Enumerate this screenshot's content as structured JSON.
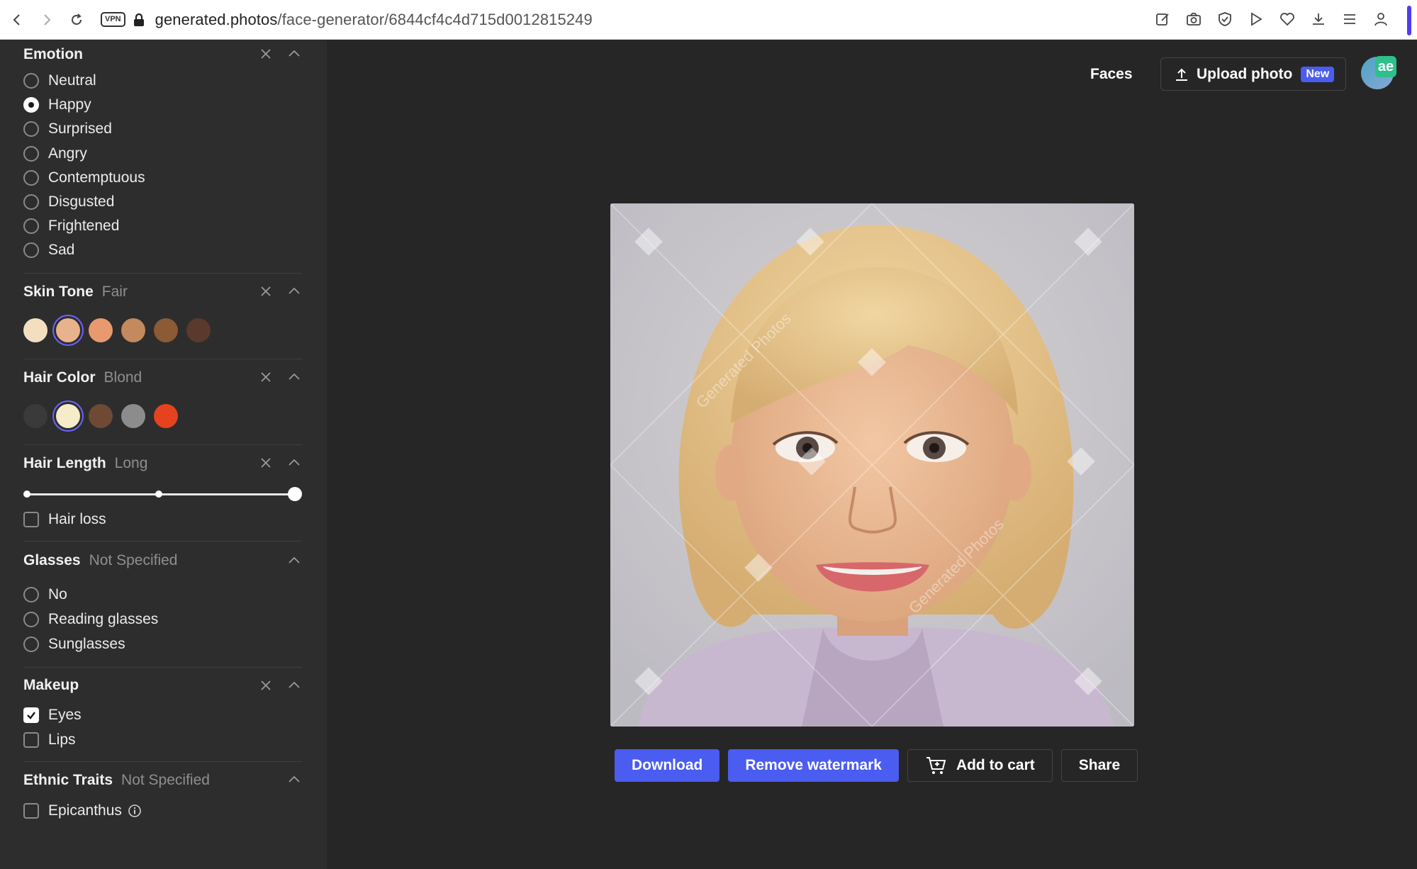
{
  "browser": {
    "url_host": "generated.photos",
    "url_path": "/face-generator/6844cf4c4d715d0012815249",
    "vpn_label": "VPN"
  },
  "sidebar": {
    "emotion": {
      "title": "Emotion",
      "options": [
        {
          "label": "Neutral",
          "selected": false
        },
        {
          "label": "Happy",
          "selected": true
        },
        {
          "label": "Surprised",
          "selected": false
        },
        {
          "label": "Angry",
          "selected": false
        },
        {
          "label": "Contemptuous",
          "selected": false
        },
        {
          "label": "Disgusted",
          "selected": false
        },
        {
          "label": "Frightened",
          "selected": false
        },
        {
          "label": "Sad",
          "selected": false
        }
      ]
    },
    "skin_tone": {
      "title": "Skin Tone",
      "value": "Fair",
      "swatches": [
        "#f3dfbf",
        "#e8b38c",
        "#e89a6e",
        "#c48a5e",
        "#8d5a36",
        "#5a3a2c"
      ],
      "selected_index": 1
    },
    "hair_color": {
      "title": "Hair Color",
      "value": "Blond",
      "swatches": [
        "#3a3a3a",
        "#f7ecc9",
        "#6e4a34",
        "#8c8c8c",
        "#e6421f"
      ],
      "selected_index": 1
    },
    "hair_length": {
      "title": "Hair Length",
      "value": "Long",
      "slider_level": 1.0,
      "hair_loss_label": "Hair loss",
      "hair_loss_checked": false
    },
    "glasses": {
      "title": "Glasses",
      "value": "Not Specified",
      "options": [
        {
          "label": "No",
          "selected": false
        },
        {
          "label": "Reading glasses",
          "selected": false
        },
        {
          "label": "Sunglasses",
          "selected": false
        }
      ]
    },
    "makeup": {
      "title": "Makeup",
      "options": [
        {
          "label": "Eyes",
          "checked": true
        },
        {
          "label": "Lips",
          "checked": false
        }
      ]
    },
    "ethnic": {
      "title": "Ethnic Traits",
      "value": "Not Specified",
      "epicanthus_label": "Epicanthus",
      "epicanthus_checked": false
    }
  },
  "header": {
    "faces_label": "Faces",
    "upload_label": "Upload photo",
    "new_badge": "New",
    "avatar_badge": "ae"
  },
  "photo": {
    "watermark": "Generated Photos"
  },
  "actions": {
    "download": "Download",
    "remove_watermark": "Remove watermark",
    "add_to_cart": "Add to cart",
    "share": "Share"
  },
  "colors": {
    "accent": "#4b5cf0",
    "sidebar_bg": "#2d2d2d",
    "main_bg": "#262626"
  }
}
